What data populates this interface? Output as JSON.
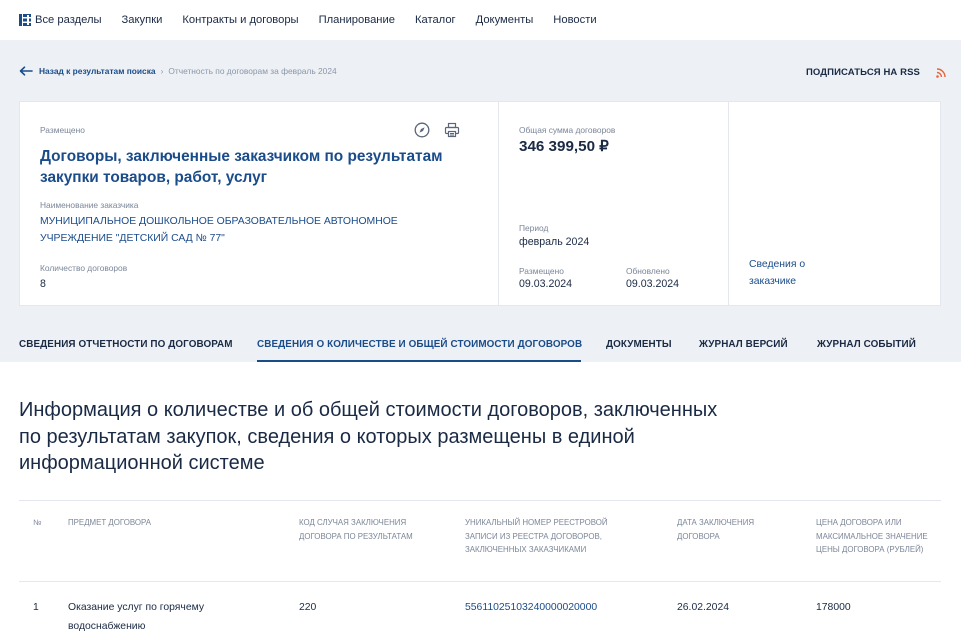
{
  "nav": {
    "items": [
      "Все разделы",
      "Закупки",
      "Контракты и договоры",
      "Планирование",
      "Каталог",
      "Документы",
      "Новости"
    ]
  },
  "breadcrumb": {
    "back": "Назад к результатам поиска",
    "separator": "›",
    "current": "Отчетность по договорам за февраль 2024"
  },
  "rss": {
    "label": "ПОДПИСАТЬСЯ НА RSS"
  },
  "card": {
    "status_label": "Размещено",
    "title": "Договоры, заключенные заказчиком по результатам закупки товаров, работ, услуг",
    "customer_label": "Наименование заказчика",
    "customer_name": "МУНИЦИПАЛЬНОЕ ДОШКОЛЬНОЕ ОБРАЗОВАТЕЛЬНОЕ АВТОНОМНОЕ УЧРЕЖДЕНИЕ \"ДЕТСКИЙ САД № 77\"",
    "count_label": "Количество договоров",
    "count_value": "8",
    "sum_label": "Общая сумма договоров",
    "sum_value": "346 399,50 ₽",
    "period_label": "Период",
    "period_value": "февраль 2024",
    "placed_label": "Размещено",
    "placed_value": "09.03.2024",
    "updated_label": "Обновлено",
    "updated_value": "09.03.2024",
    "customer_link": "Сведения о заказчике"
  },
  "tabs": [
    "СВЕДЕНИЯ ОТЧЕТНОСТИ ПО ДОГОВОРАМ",
    "СВЕДЕНИЯ О КОЛИЧЕСТВЕ И ОБЩЕЙ СТОИМОСТИ ДОГОВОРОВ",
    "ДОКУМЕНТЫ",
    "ЖУРНАЛ ВЕРСИЙ",
    "ЖУРНАЛ СОБЫТИЙ"
  ],
  "section": {
    "heading": "Информация о количестве и об общей стоимости договоров, заключенных по результатам закупок, сведения о которых размещены в единой информационной системе"
  },
  "table": {
    "headers": [
      "№",
      "Предмет договора",
      "Код случая заключения договора по результатам",
      "Уникальный номер реестровой записи из реестра договоров, заключенных заказчиками",
      "Дата заключения договора",
      "Цена договора или максимальное значение цены договора (рублей)"
    ],
    "rows": [
      [
        "1",
        "Оказание услуг по горячему водоснабжению",
        "220",
        "55611025103240000020000",
        "26.02.2024",
        "178000"
      ]
    ]
  },
  "colors": {
    "accent": "#1b4c8a",
    "rss": "#e8643c",
    "background": "#edf1f5"
  }
}
